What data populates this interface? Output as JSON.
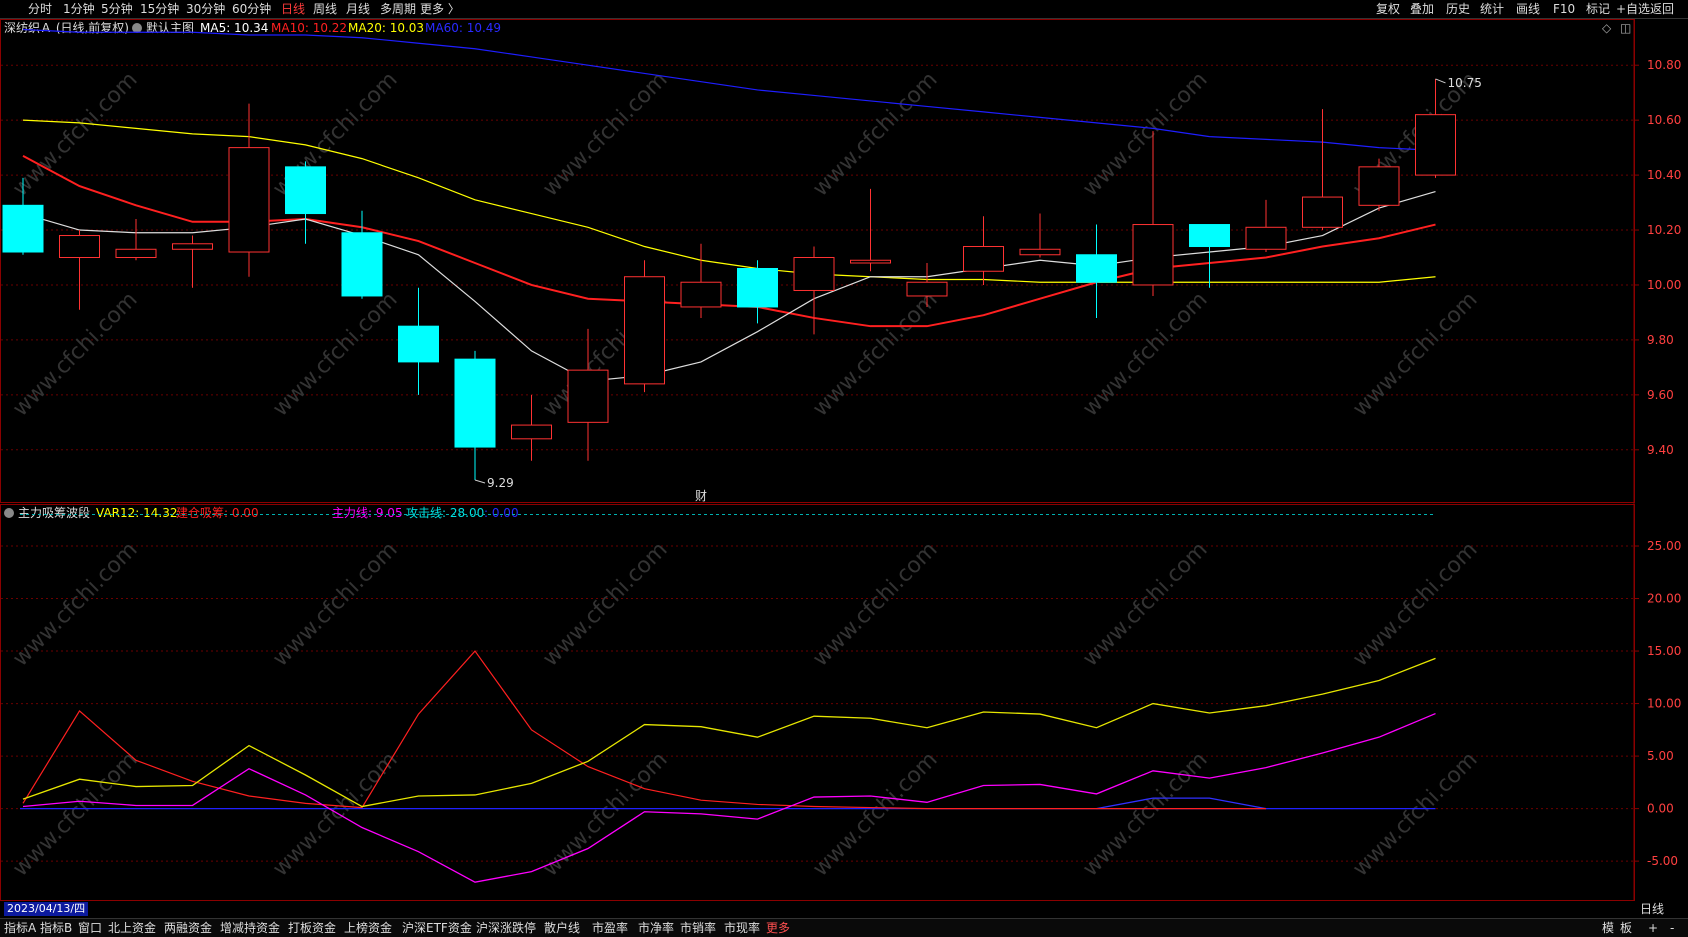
{
  "topbar": {
    "left": [
      "分时",
      "1分钟",
      "5分钟",
      "15分钟",
      "30分钟",
      "60分钟",
      "日线",
      "周线",
      "月线",
      "多周期",
      "更多 〉"
    ],
    "active_index": 6,
    "right": [
      "复权",
      "叠加",
      "历史",
      "统计",
      "画线",
      "F10",
      "标记",
      "+自选",
      "返回"
    ]
  },
  "main_legend": {
    "stock": "深纺织Ａ (日线,前复权)",
    "indicator": "默认主图",
    "ma5": "MA5: 10.34",
    "ma10": "MA10: 10.22",
    "ma20": "MA20: 10.03",
    "ma60": "MA60: 10.49"
  },
  "sub_legend": {
    "name": "主力吸筹波段",
    "var12": "VAR12: 14.32",
    "jiancang": "建仓吸筹: 0.00",
    "zhuli": "主力线: 9.05",
    "gongji": "攻击线: 28.00",
    "blue": ": 0.00"
  },
  "price_axis": [
    "10.80",
    "10.60",
    "10.40",
    "10.20",
    "10.00",
    "9.80",
    "9.60",
    "9.40"
  ],
  "sub_axis": [
    "25.00",
    "20.00",
    "15.00",
    "10.00",
    "5.00",
    "0.00",
    "-5.00"
  ],
  "annotations": {
    "high": "10.75",
    "low": "9.29",
    "cai": "财",
    "sep": "5"
  },
  "date": "2023/04/13/四",
  "period": "日线",
  "bottombar": {
    "items": [
      "指标A",
      "指标B",
      "窗口",
      "北上资金",
      "两融资金",
      "增减持资金",
      "打板资金",
      "上榜资金",
      "沪深ETF资金",
      "沪深涨跌停",
      "散户线",
      "市盈率",
      "市净率",
      "市销率",
      "市现率",
      "更多"
    ],
    "active_index": 15,
    "right": [
      "模",
      "板",
      "+",
      "-"
    ]
  },
  "watermark": "www.cfchi.com",
  "colors": {
    "up": "#ff3232",
    "down": "#00ffff",
    "ma5": "#ffffff",
    "ma10": "#ff2020",
    "ma20": "#ffff00",
    "ma60": "#1e1eff",
    "magenta": "#ff00ff"
  },
  "chart_data": {
    "type": "candlestick",
    "candles": [
      {
        "o": 10.29,
        "h": 10.39,
        "l": 10.11,
        "c": 10.12
      },
      {
        "o": 10.1,
        "h": 10.2,
        "l": 9.91,
        "c": 10.18
      },
      {
        "o": 10.1,
        "h": 10.24,
        "l": 10.09,
        "c": 10.13
      },
      {
        "o": 10.13,
        "h": 10.18,
        "l": 9.99,
        "c": 10.15
      },
      {
        "o": 10.12,
        "h": 10.66,
        "l": 10.03,
        "c": 10.5
      },
      {
        "o": 10.43,
        "h": 10.45,
        "l": 10.15,
        "c": 10.26
      },
      {
        "o": 10.19,
        "h": 10.27,
        "l": 9.95,
        "c": 9.96
      },
      {
        "o": 9.85,
        "h": 9.99,
        "l": 9.6,
        "c": 9.72
      },
      {
        "o": 9.73,
        "h": 9.76,
        "l": 9.29,
        "c": 9.41
      },
      {
        "o": 9.44,
        "h": 9.6,
        "l": 9.36,
        "c": 9.49
      },
      {
        "o": 9.5,
        "h": 9.84,
        "l": 9.36,
        "c": 9.69
      },
      {
        "o": 9.64,
        "h": 10.09,
        "l": 9.61,
        "c": 10.03
      },
      {
        "o": 9.92,
        "h": 10.15,
        "l": 9.88,
        "c": 10.01
      },
      {
        "o": 10.06,
        "h": 10.09,
        "l": 9.86,
        "c": 9.92
      },
      {
        "o": 9.98,
        "h": 10.14,
        "l": 9.82,
        "c": 10.1
      },
      {
        "o": 10.08,
        "h": 10.35,
        "l": 10.05,
        "c": 10.09
      },
      {
        "o": 9.96,
        "h": 10.08,
        "l": 9.92,
        "c": 10.01
      },
      {
        "o": 10.05,
        "h": 10.25,
        "l": 10.0,
        "c": 10.14
      },
      {
        "o": 10.11,
        "h": 10.26,
        "l": 10.1,
        "c": 10.13
      },
      {
        "o": 10.11,
        "h": 10.22,
        "l": 9.88,
        "c": 10.01
      },
      {
        "o": 10.0,
        "h": 10.56,
        "l": 9.96,
        "c": 10.22
      },
      {
        "o": 10.22,
        "h": 10.22,
        "l": 9.99,
        "c": 10.14
      },
      {
        "o": 10.13,
        "h": 10.31,
        "l": 10.12,
        "c": 10.21
      },
      {
        "o": 10.21,
        "h": 10.64,
        "l": 10.2,
        "c": 10.32
      },
      {
        "o": 10.29,
        "h": 10.46,
        "l": 10.27,
        "c": 10.43
      },
      {
        "o": 10.4,
        "h": 10.75,
        "l": 10.39,
        "c": 10.62
      }
    ],
    "ma5": [
      10.26,
      10.2,
      10.19,
      10.19,
      10.21,
      10.24,
      10.18,
      10.11,
      9.94,
      9.76,
      9.65,
      9.67,
      9.72,
      9.83,
      9.95,
      10.03,
      10.03,
      10.06,
      10.09,
      10.07,
      10.1,
      10.12,
      10.14,
      10.18,
      10.28,
      10.34
    ],
    "ma10": [
      10.47,
      10.36,
      10.29,
      10.23,
      10.23,
      10.24,
      10.21,
      10.16,
      10.08,
      10.0,
      9.95,
      9.94,
      9.93,
      9.92,
      9.88,
      9.85,
      9.85,
      9.89,
      9.95,
      10.01,
      10.06,
      10.08,
      10.1,
      10.14,
      10.17,
      10.22
    ],
    "ma20": [
      10.6,
      10.59,
      10.57,
      10.55,
      10.54,
      10.51,
      10.46,
      10.39,
      10.31,
      10.26,
      10.21,
      10.14,
      10.09,
      10.06,
      10.04,
      10.03,
      10.02,
      10.02,
      10.01,
      10.01,
      10.01,
      10.01,
      10.01,
      10.01,
      10.01,
      10.03
    ],
    "ma60": [
      10.93,
      10.92,
      10.92,
      10.92,
      10.91,
      10.91,
      10.9,
      10.88,
      10.86,
      10.83,
      10.8,
      10.77,
      10.74,
      10.71,
      10.69,
      10.67,
      10.65,
      10.63,
      10.61,
      10.59,
      10.57,
      10.54,
      10.53,
      10.52,
      10.5,
      10.49
    ],
    "price_range": [
      9.21,
      10.95
    ],
    "sub": {
      "range": [
        -8.7,
        29
      ],
      "var12": [
        0.9,
        2.8,
        2.1,
        2.2,
        6.0,
        3.2,
        0.2,
        1.2,
        1.3,
        2.4,
        4.5,
        8.0,
        7.8,
        6.8,
        8.8,
        8.6,
        7.7,
        9.2,
        9.0,
        7.7,
        10.0,
        9.1,
        9.8,
        10.9,
        12.2,
        14.3
      ],
      "red": [
        0.5,
        9.3,
        4.6,
        2.6,
        1.2,
        0.5,
        0.1,
        9.0,
        15.0,
        7.5,
        4.0,
        1.9,
        0.8,
        0.4,
        0.2,
        0.1,
        0.0,
        0.0,
        0.0,
        0.0,
        0.0,
        0.0,
        0.0,
        null,
        null,
        null
      ],
      "magenta": [
        0.2,
        0.7,
        0.3,
        0.3,
        3.8,
        1.3,
        -1.8,
        -4.1,
        -7.0,
        -6.0,
        -3.8,
        -0.3,
        -0.5,
        -1.0,
        1.1,
        1.2,
        0.6,
        2.2,
        2.3,
        1.4,
        3.6,
        2.9,
        3.9,
        5.3,
        6.8,
        9.05
      ],
      "blue": [
        null,
        null,
        null,
        null,
        null,
        null,
        null,
        null,
        null,
        null,
        null,
        null,
        null,
        null,
        null,
        null,
        null,
        null,
        null,
        0.0,
        1.0,
        1.0,
        0.0,
        null,
        null,
        null
      ],
      "attack": 28.0
    }
  }
}
